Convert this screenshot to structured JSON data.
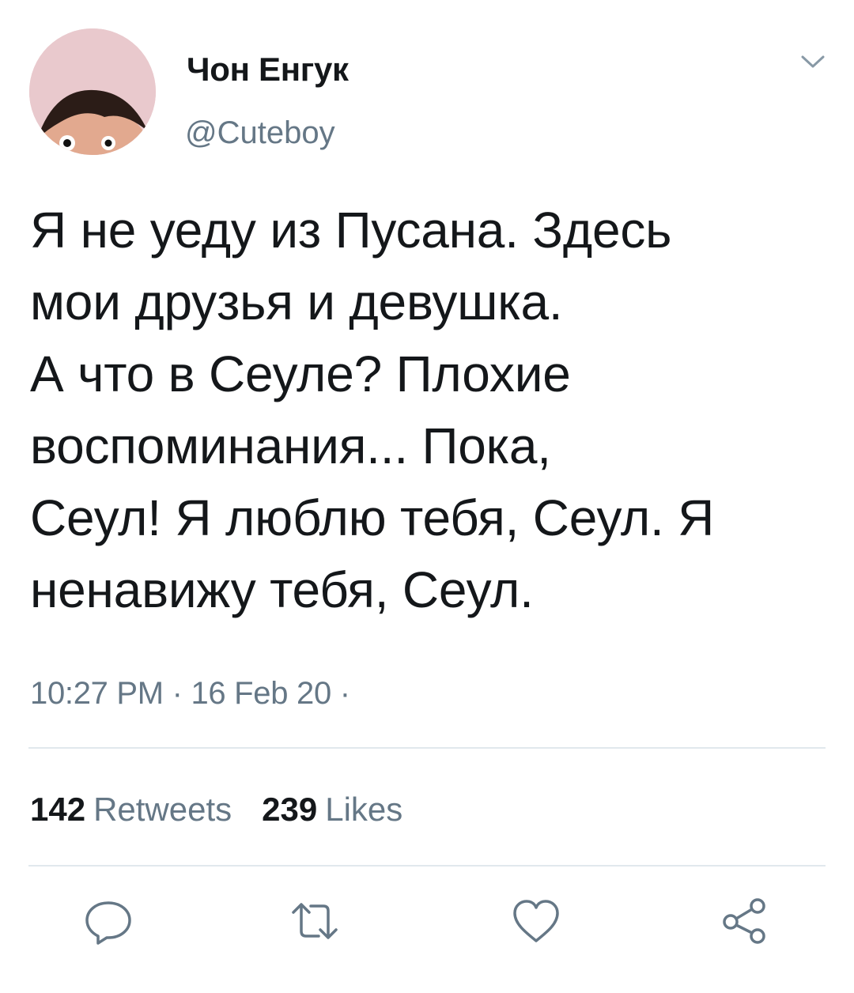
{
  "user": {
    "name": "Чон Енгук",
    "handle": "@Cuteboy",
    "avatar_icon": "profile-photo"
  },
  "tweet": {
    "text": "Я не уеду из Пусана. Здесь\nмои друзья и девушка.\nА что в Сеуле? Плохие\nвоспоминания... Пока,\nСеул! Я люблю тебя, Сеул. Я\nненавижу тебя, Сеул.",
    "timestamp": "10:27 PM · 16 Feb 20 ·"
  },
  "stats": {
    "retweets_count": "142",
    "retweets_label": "Retweets",
    "likes_count": "239",
    "likes_label": "Likes"
  },
  "actions": [
    {
      "name": "reply",
      "icon": "reply-icon"
    },
    {
      "name": "retweet",
      "icon": "retweet-icon"
    },
    {
      "name": "like",
      "icon": "heart-icon"
    },
    {
      "name": "share",
      "icon": "share-icon"
    }
  ],
  "colors": {
    "text": "#14171a",
    "secondary": "#657786",
    "divider": "#e1e8ed",
    "icon": "#657786"
  }
}
